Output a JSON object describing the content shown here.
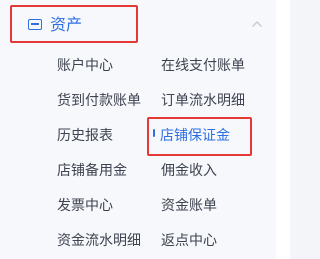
{
  "colors": {
    "accent": "#2f6fe4",
    "highlight_border": "#e53935",
    "text": "#3e4350",
    "sidebar_bg": "#f6f8fb"
  },
  "section": {
    "icon": "wallet-icon",
    "title": "资产",
    "collapse_icon": "chevron-up-icon"
  },
  "menu": {
    "items": [
      {
        "label": "账户中心"
      },
      {
        "label": "在线支付账单"
      },
      {
        "label": "货到付款账单"
      },
      {
        "label": "订单流水明细"
      },
      {
        "label": "历史报表"
      },
      {
        "label": "店铺保证金",
        "active": true
      },
      {
        "label": "店铺备用金"
      },
      {
        "label": "佣金收入"
      },
      {
        "label": "发票中心"
      },
      {
        "label": "资金账单"
      },
      {
        "label": "资金流水明细"
      },
      {
        "label": "返点中心"
      }
    ]
  }
}
